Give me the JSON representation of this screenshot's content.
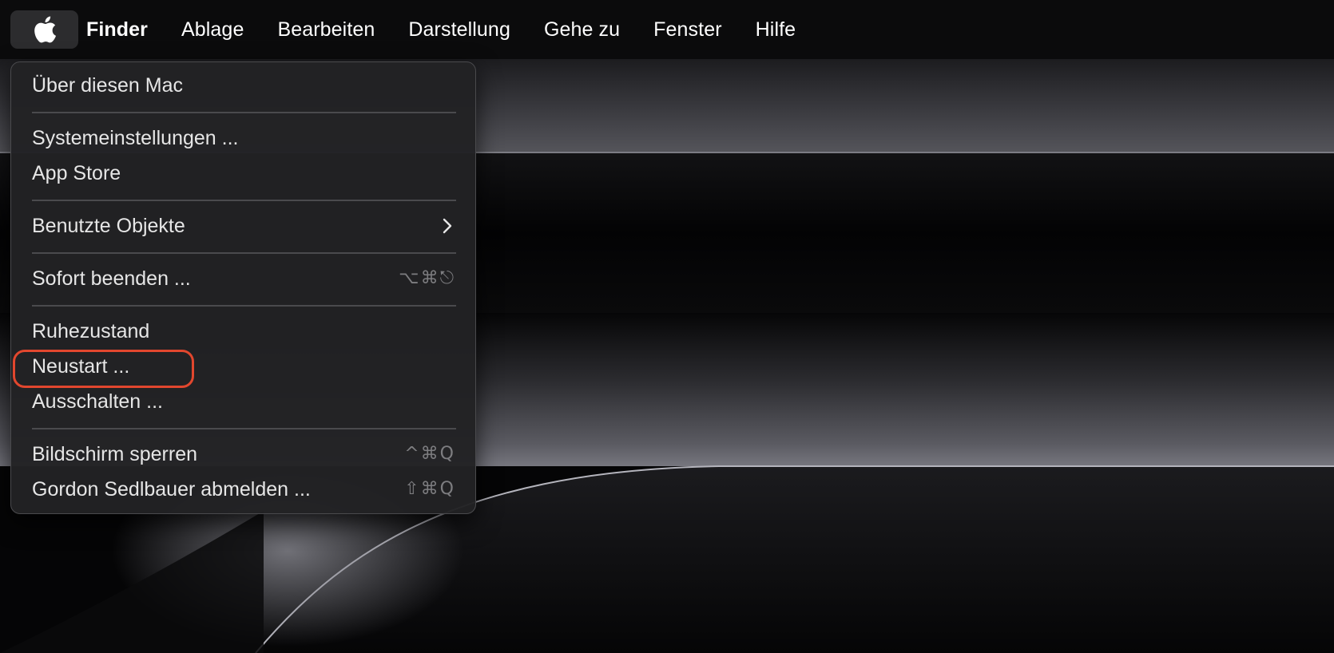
{
  "menubar": {
    "apple_icon": "apple-logo-icon",
    "app_name": "Finder",
    "items": [
      "Ablage",
      "Bearbeiten",
      "Darstellung",
      "Gehe zu",
      "Fenster",
      "Hilfe"
    ]
  },
  "apple_menu": {
    "items": [
      {
        "label": "Über diesen Mac"
      },
      {
        "label": "Systemeinstellungen ..."
      },
      {
        "label": "App Store"
      },
      {
        "label": "Benutzte Objekte",
        "submenu_icon": "chevron-right-icon"
      },
      {
        "label": "Sofort beenden ...",
        "shortcut": "⌥⌘⎋"
      },
      {
        "label": "Ruhezustand"
      },
      {
        "label": "Neustart ..."
      },
      {
        "label": "Ausschalten ..."
      },
      {
        "label": "Bildschirm sperren",
        "shortcut": "^⌘Q"
      },
      {
        "label": "Gordon Sedlbauer abmelden ...",
        "shortcut": "⇧⌘Q"
      }
    ]
  },
  "colors": {
    "menubar_bg": "#0b0b0c",
    "menu_bg": "#222224",
    "menu_text": "#e6e6e6",
    "shortcut_text": "#7d7d80",
    "highlight_ring": "#e2472e"
  }
}
